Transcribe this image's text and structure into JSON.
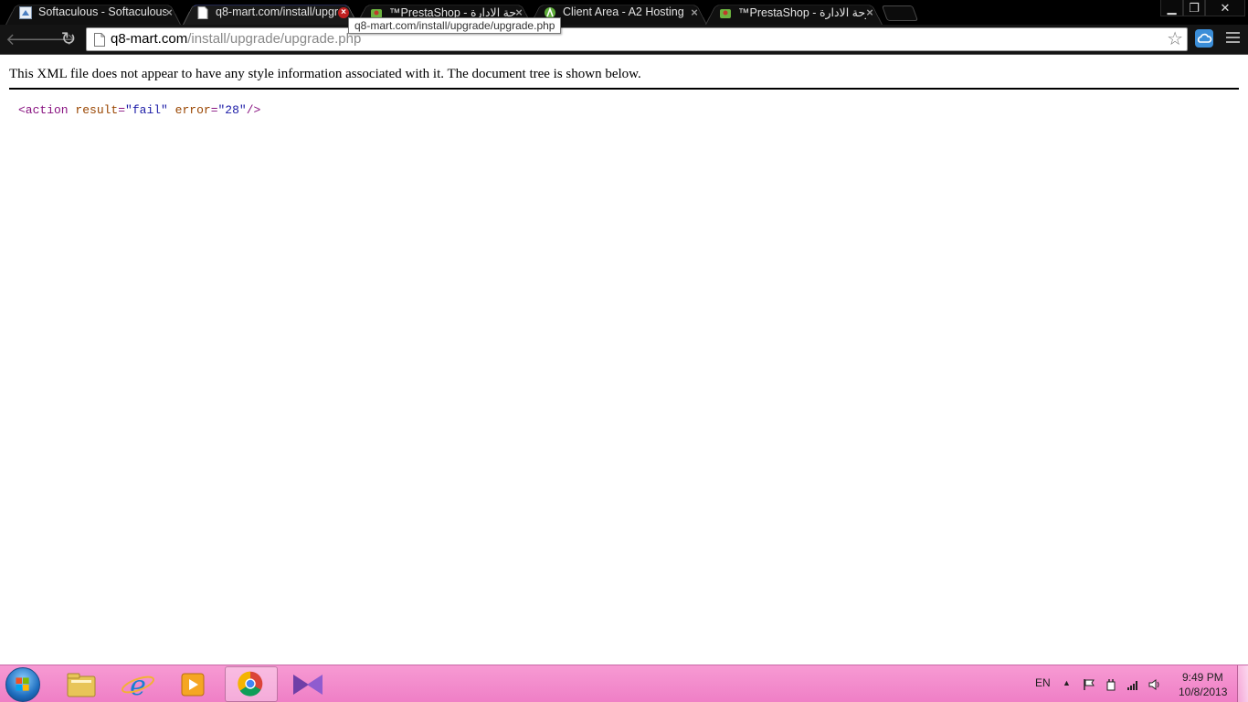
{
  "tabs": [
    {
      "title": "Softaculous - Softaculous",
      "favicon": "softaculous-icon",
      "active": false
    },
    {
      "title": "q8-mart.com/install/upgr",
      "favicon": "page-icon",
      "active": true
    },
    {
      "title": "™PrestaShop - لوحة الادارة",
      "favicon": "prestashop-icon",
      "active": false
    },
    {
      "title": "Client Area - A2 Hosting",
      "favicon": "a2hosting-icon",
      "active": false
    },
    {
      "title": "™PrestaShop - لوحة الادارة",
      "favicon": "prestashop-icon",
      "active": false
    }
  ],
  "tab_close_glyph": "×",
  "window_controls": {
    "minimize": "▁",
    "restore": "❐",
    "close": "✕"
  },
  "toolbar": {
    "url_host": "q8-mart.com",
    "url_path": "/install/upgrade/upgrade.php",
    "back_glyph": "🡐",
    "forward_glyph": "🡒",
    "reload_glyph": "↻",
    "star_glyph": "☆"
  },
  "tooltip": "q8-mart.com/install/upgrade/upgrade.php",
  "page": {
    "notice": "This XML file does not appear to have any style information associated with it. The document tree is shown below.",
    "xml": {
      "open": "<action",
      "attr1_name": "result",
      "attr1_value": "\"fail\"",
      "attr2_name": "error",
      "attr2_value": "\"28\"",
      "close": "/>"
    }
  },
  "taskbar": {
    "apps": [
      "explorer-icon",
      "ie-icon",
      "media-player-icon",
      "chrome-icon",
      "visual-studio-icon"
    ],
    "language": "EN",
    "tray_arrow": "▲",
    "clock_time": "9:49 PM",
    "clock_date": "10/8/2013"
  },
  "colors": {
    "tag": "#881280",
    "attr_name": "#994500",
    "attr_value": "#1a1aa6",
    "taskbar": "#f48ccd"
  }
}
